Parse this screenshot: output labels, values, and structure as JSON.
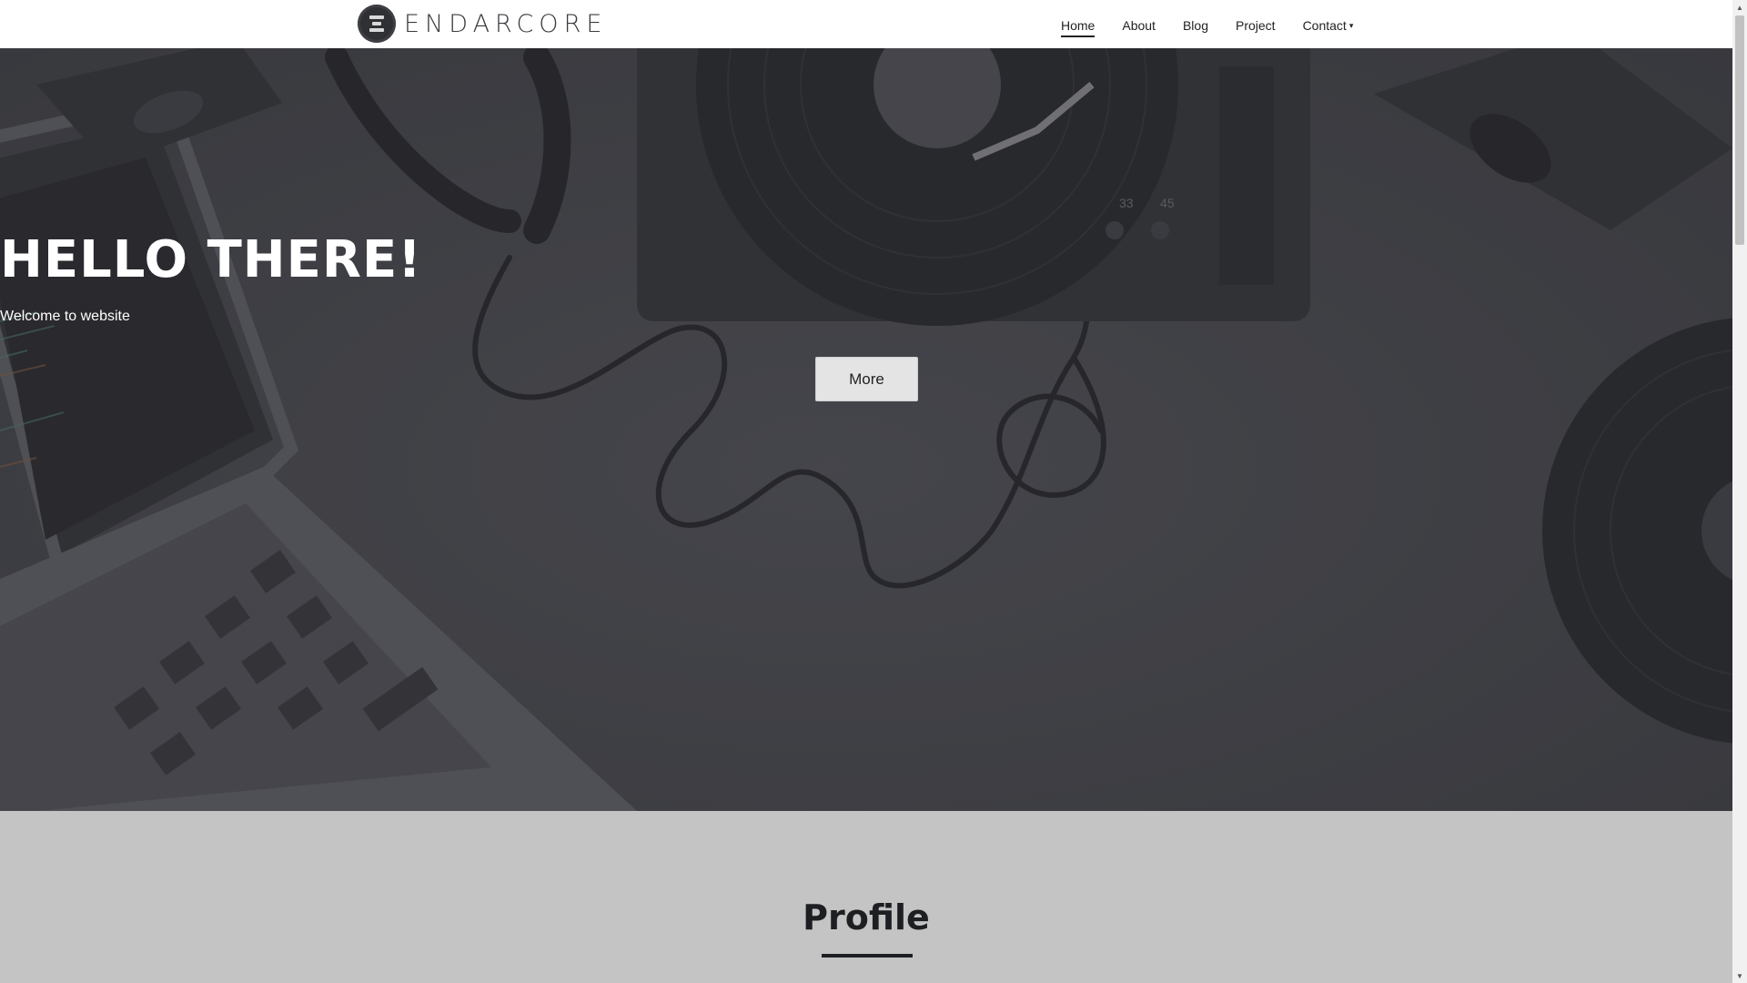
{
  "brand": {
    "name": "ENDARCORE",
    "logo_icon": "stacked-bars-logo-icon"
  },
  "nav": {
    "items": [
      {
        "label": "Home",
        "active": true
      },
      {
        "label": "About"
      },
      {
        "label": "Blog"
      },
      {
        "label": "Project"
      },
      {
        "label": "Contact",
        "has_dropdown": true,
        "dropdown_icon": "chevron-down-icon"
      }
    ]
  },
  "hero": {
    "title": "HELLO THERE!",
    "subtitle": "Welcome to website",
    "button_label": "More",
    "background": "desk-with-laptop-headphones-turntable-photo"
  },
  "profile": {
    "title": "Profile"
  },
  "colors": {
    "header_bg": "#ffffff",
    "hero_overlay": "#414247",
    "section_bg": "#c4c4c4",
    "button_bg": "#e4e4e4",
    "heading_dark": "#1e1f22"
  }
}
